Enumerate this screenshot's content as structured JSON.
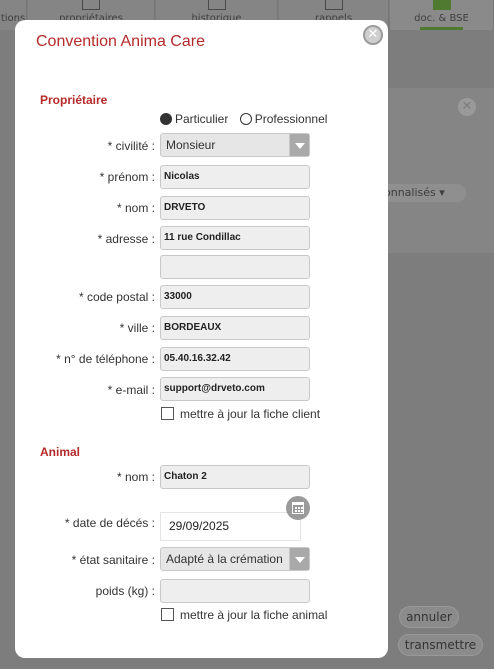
{
  "background": {
    "tabs": [
      {
        "label": "tions"
      },
      {
        "label": "propriétaires"
      },
      {
        "label": "historique"
      },
      {
        "label": "rappels"
      },
      {
        "label": "doc. & BSE"
      }
    ],
    "panel_pill": "onnalisés ▾",
    "cancel_label": "annuler",
    "send_label": "transmettre"
  },
  "modal": {
    "title": "Convention Anima Care",
    "close_glyph": "✕"
  },
  "owner": {
    "section_title": "Propriétaire",
    "type_options": [
      "Particulier",
      "Professionnel"
    ],
    "type_selected": "Particulier",
    "civilite_label": "* civilité :",
    "civilite_value": "Monsieur",
    "prenom_label": "* prénom :",
    "prenom_value": "Nicolas",
    "nom_label": "* nom :",
    "nom_value": "DRVETO",
    "adresse_label": "* adresse :",
    "adresse_value": "11 rue Condillac",
    "adresse2_value": "",
    "cp_label": "* code postal :",
    "cp_value": "33000",
    "ville_label": "* ville :",
    "ville_value": "BORDEAUX",
    "tel_label": "* n° de téléphone :",
    "tel_value": "05.40.16.32.42",
    "email_label": "* e-mail :",
    "email_value": "support@drveto.com",
    "update_label": "mettre à jour la fiche client"
  },
  "animal": {
    "section_title": "Animal",
    "nom_label": "* nom :",
    "nom_value": "Chaton 2",
    "deces_label": "* date de décés :",
    "deces_value": "29/09/2025",
    "etat_label": "* état sanitaire :",
    "etat_value": "Adapté à la crémation",
    "poids_label": "poids (kg) :",
    "poids_value": "",
    "update_label": "mettre à jour la fiche animal"
  }
}
